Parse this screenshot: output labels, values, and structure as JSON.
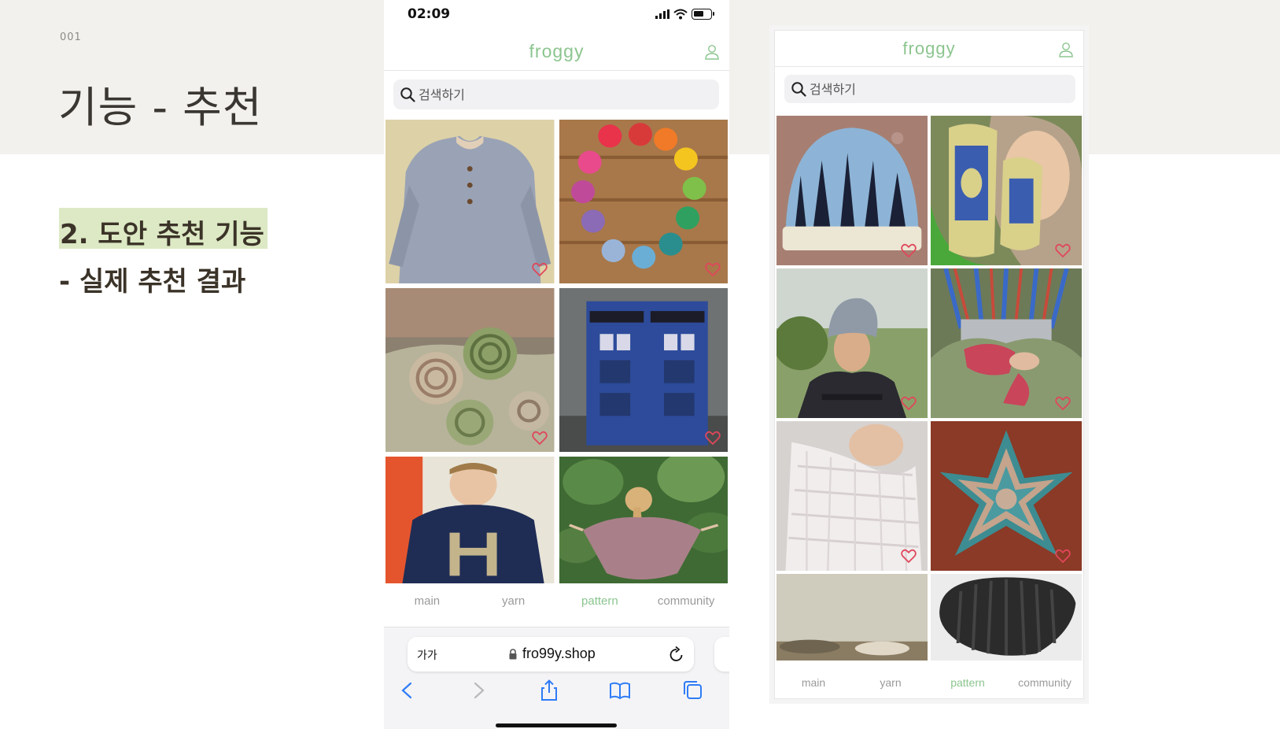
{
  "slide": {
    "number": "001",
    "title": "기능 - 추천",
    "section_label": "2. 도안 추천 기능",
    "section_sub": "- 실제 추천 결과"
  },
  "phone": {
    "status_time": "02:09",
    "app_logo": "froggy",
    "search_placeholder": "검색하기",
    "tabs": [
      {
        "label": "main"
      },
      {
        "label": "yarn"
      },
      {
        "label": "pattern"
      },
      {
        "label": "community"
      }
    ],
    "active_tab": "pattern",
    "browser": {
      "text_size_label": "가가",
      "url": "fro99y.shop"
    },
    "images": [
      {
        "name": "grey-lace-cardigan",
        "icon": "heart-icon"
      },
      {
        "name": "rainbow-knit-bunnies",
        "icon": "heart-icon"
      },
      {
        "name": "spiral-blanket",
        "icon": "heart-icon"
      },
      {
        "name": "police-box-knit",
        "icon": "heart-icon"
      },
      {
        "name": "h-letter-sweater",
        "icon": "heart-icon"
      },
      {
        "name": "lace-shawl-girl",
        "icon": "heart-icon"
      }
    ]
  },
  "web": {
    "app_logo": "froggy",
    "search_placeholder": "검색하기",
    "tabs": [
      {
        "label": "main"
      },
      {
        "label": "yarn"
      },
      {
        "label": "pattern"
      },
      {
        "label": "community"
      }
    ],
    "active_tab": "pattern",
    "images": [
      {
        "name": "forest-beanie",
        "icon": "heart-icon"
      },
      {
        "name": "totoro-mittens",
        "icon": "heart-icon"
      },
      {
        "name": "cable-slouch-hat",
        "icon": "heart-icon"
      },
      {
        "name": "pink-fingerless-gloves",
        "icon": "heart-icon"
      },
      {
        "name": "white-lace-shawl",
        "icon": "heart-icon"
      },
      {
        "name": "crochet-star-doily",
        "icon": "heart-icon"
      },
      {
        "name": "knit-baby-blanket",
        "icon": "heart-icon"
      },
      {
        "name": "ribbed-black-hat",
        "icon": "heart-icon"
      }
    ]
  },
  "colors": {
    "brand_green": "#8cc58f",
    "highlight": "#dce9c4",
    "heart": "#e0475b",
    "band": "#f2f1ed"
  }
}
